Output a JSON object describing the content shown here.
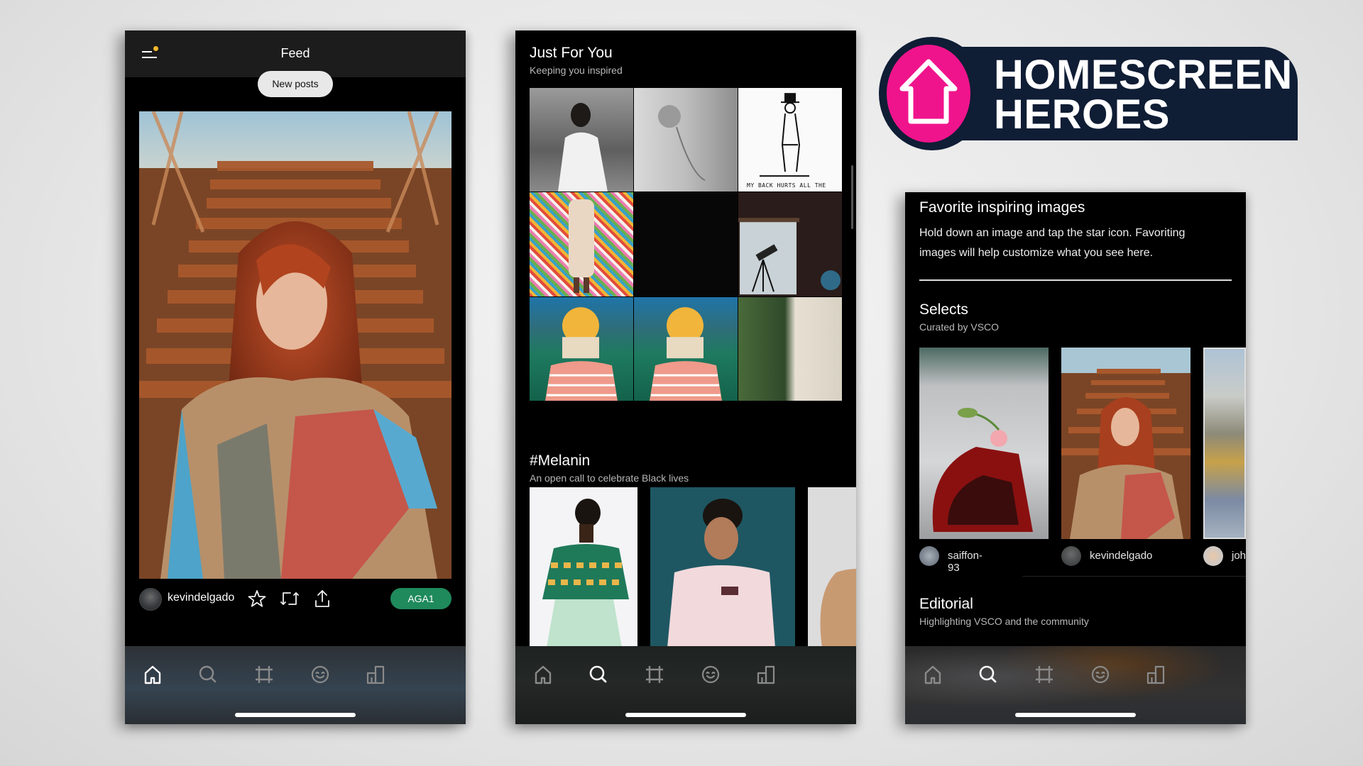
{
  "logo": {
    "line1": "HOMESCREEN",
    "line2": "HEROES",
    "icon": "house-icon",
    "colors": {
      "circle": "#f0148c",
      "bar": "#0f1d35",
      "text": "#ffffff"
    }
  },
  "phone1": {
    "header": {
      "title": "Feed",
      "menu_icon": "menu-icon",
      "notification_dot_color": "#f4b82c"
    },
    "new_posts_label": "New posts",
    "post": {
      "image": "redhead-woman-on-stairs-photo",
      "username": "kevindelgado",
      "actions": [
        "star-icon",
        "repost-icon",
        "share-icon"
      ],
      "preset_label": "AGA1",
      "preset_color": "#1f8a5c"
    },
    "nav": {
      "items": [
        "home",
        "search",
        "studio",
        "emoji",
        "profile"
      ],
      "active": "home"
    }
  },
  "phone2": {
    "section1": {
      "title": "Just For You",
      "subtitle": "Keeping you inspired",
      "tiles": [
        "woman-in-white-shirt",
        "shower-head",
        "sketch-man-with-hat",
        "girl-on-rainbow-pattern",
        "dark-image",
        "telescope-by-window",
        "yellow-beanie-tennis-court",
        "yellow-beanie-tennis-court-2",
        "mossy-wall"
      ],
      "sketch_caption": "MY BACK HURTS ALL THE"
    },
    "section2": {
      "title": "#Melanin",
      "subtitle": "An open call to celebrate Black lives",
      "cards": [
        "woman-kente-cape",
        "man-pink-sweater",
        "shoulder-partial"
      ]
    },
    "nav": {
      "items": [
        "home",
        "search",
        "studio",
        "emoji",
        "profile"
      ],
      "active": "search"
    }
  },
  "phone3": {
    "favorites": {
      "title": "Favorite inspiring images",
      "body": "Hold down an image and tap the star icon. Favoriting images will help customize what you see here."
    },
    "selects": {
      "title": "Selects",
      "subtitle": "Curated by VSCO",
      "cards": [
        {
          "image": "rose-on-car",
          "username": "saiffon-93"
        },
        {
          "image": "redhead-woman-on-stairs",
          "username": "kevindelgado"
        },
        {
          "image": "city-aerial",
          "username": "joh"
        }
      ]
    },
    "editorial": {
      "title": "Editorial",
      "subtitle": "Highlighting VSCO and the community"
    },
    "nav": {
      "items": [
        "home",
        "search",
        "studio",
        "emoji",
        "profile"
      ],
      "active": "search"
    }
  }
}
